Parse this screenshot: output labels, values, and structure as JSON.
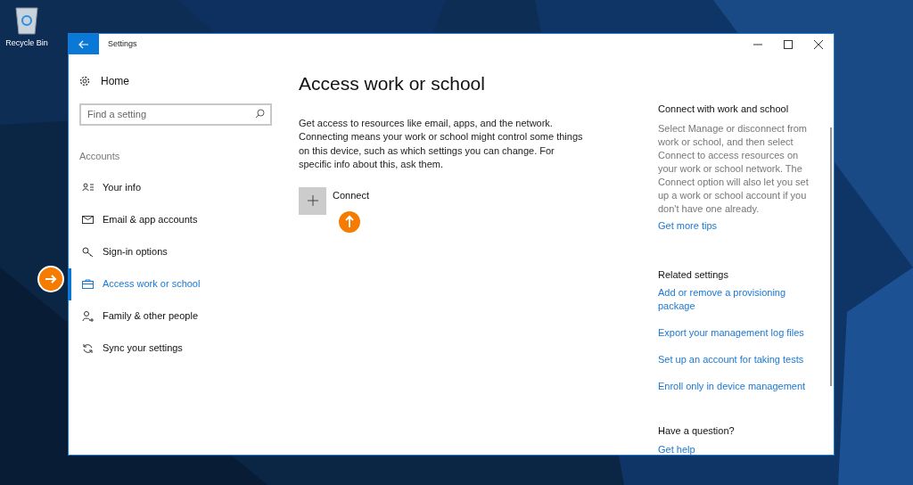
{
  "desktop": {
    "icons": [
      {
        "label": "Recycle Bin"
      }
    ]
  },
  "window": {
    "title": "Settings"
  },
  "sidebar": {
    "home": "Home",
    "search": {
      "placeholder": "Find a setting"
    },
    "section": "Accounts",
    "items": [
      {
        "label": "Your info",
        "selected": false
      },
      {
        "label": "Email & app accounts",
        "selected": false
      },
      {
        "label": "Sign-in options",
        "selected": false
      },
      {
        "label": "Access work or school",
        "selected": true
      },
      {
        "label": "Family & other people",
        "selected": false
      },
      {
        "label": "Sync your settings",
        "selected": false
      }
    ]
  },
  "content": {
    "heading": "Access work or school",
    "description": "Get access to resources like email, apps, and the network. Connecting means your work or school might control some things on this device, such as which settings you can change. For specific info about this, ask them.",
    "connect_label": "Connect"
  },
  "side_panel": {
    "sections": [
      {
        "title": "Connect with work and school",
        "text": "Select Manage or disconnect from work or school, and then select Connect to access resources on your work or school network. The Connect option will also let you set up a work or school account if you don't have one already.",
        "links": [
          "Get more tips"
        ]
      },
      {
        "title": "Related settings",
        "links": [
          "Add or remove a provisioning package",
          "Export your management log files",
          "Set up an account for taking tests",
          "Enroll only in device management"
        ]
      },
      {
        "title": "Have a question?",
        "links": [
          "Get help"
        ]
      }
    ]
  }
}
